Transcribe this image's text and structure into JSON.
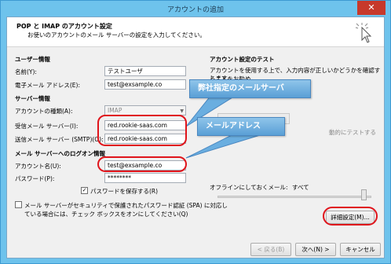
{
  "window": {
    "title": "アカウントの追加",
    "close_label": "✕"
  },
  "header": {
    "title": "POP と IMAP のアカウント設定",
    "subtitle": "お使いのアカウントのメール サーバーの設定を入力してください。"
  },
  "user_info": {
    "heading": "ユーザー情報",
    "name_label": "名前(Y):",
    "name_value": "テストユーザ",
    "email_label": "電子メール アドレス(E):",
    "email_value": "test@exsample.co"
  },
  "server_info": {
    "heading": "サーバー情報",
    "account_type_label": "アカウントの種類(A):",
    "account_type_value": "IMAP",
    "incoming_label": "受信メール サーバー(I):",
    "incoming_value": "red.rookie-saas.com",
    "outgoing_label": "送信メール サーバー (SMTP)(O):",
    "outgoing_value": "red.rookie-saas.com"
  },
  "logon_info": {
    "heading": "メール サーバーへのログオン情報",
    "account_name_label": "アカウント名(U):",
    "account_name_value": "test@exsample.co",
    "password_label": "パスワード(P):",
    "password_value": "********",
    "remember_password_label": "パスワードを保存する(R)",
    "spa_label_line1": "メール サーバーがセキュリティで保護されたパスワード認証 (SPA) に対応し",
    "spa_label_line2": "ている場合には、チェック ボックスをオンにしてください(Q)"
  },
  "test_settings": {
    "heading": "アカウント設定のテスト",
    "desc_line1": "アカウントを使用する上で、入力内容が正しいかどうかを確認することをお勧め",
    "desc_line2": "します。",
    "offline_label": "オフラインにしておくメール:",
    "offline_value": "すべて",
    "partial_text": "動的にテストする"
  },
  "buttons": {
    "more_settings": "詳細設定(M)...",
    "back": "< 戻る(B)",
    "next": "次へ(N) >",
    "cancel": "キャンセル"
  },
  "callouts": {
    "server": "弊社指定のメールサーバ",
    "email": "メールアドレス"
  },
  "colors": {
    "annotation_red": "#e0141b",
    "callout_blue": "#5a9fd6",
    "window_frame": "#6ec3ec"
  }
}
